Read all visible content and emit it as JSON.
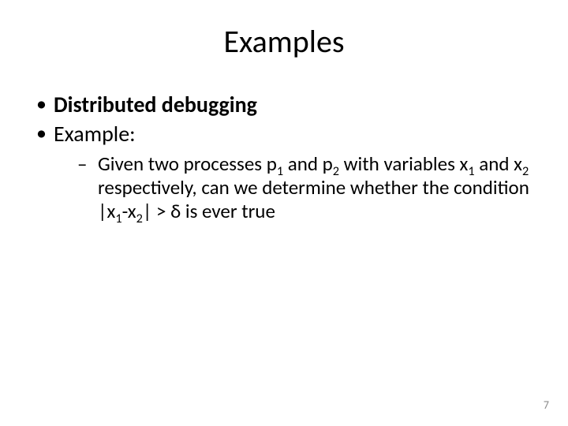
{
  "title": "Examples",
  "bullets": {
    "b1": "Distributed debugging",
    "b2": "Example:",
    "sub": {
      "t0": "Given two processes p",
      "t1": " and p",
      "t2": " with variables x",
      "t3": " and x",
      "t4": " respectively, can we determine whether the condition |x",
      "t5": "-x",
      "t6": "| > δ is ever true",
      "s1": "1",
      "s2": "2"
    }
  },
  "page_number": "7"
}
